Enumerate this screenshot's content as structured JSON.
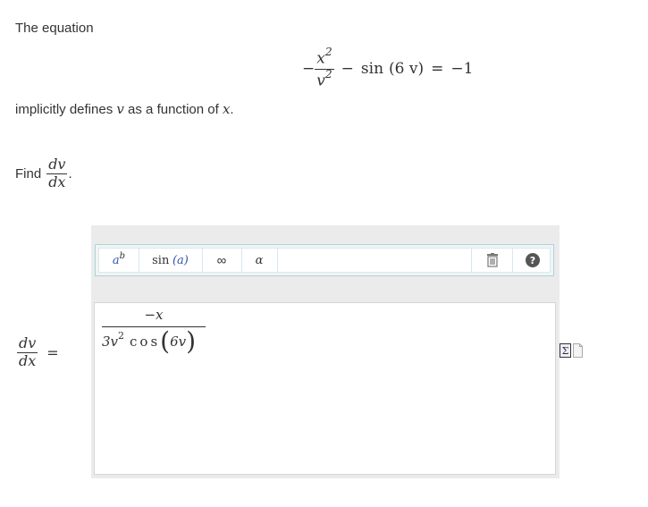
{
  "prompt": {
    "intro": "The equation",
    "implicit_prefix": "implicitly defines",
    "implicit_var_v": "v",
    "implicit_mid": "as a function of",
    "implicit_var_x": "x",
    "implicit_end": ".",
    "find_label": "Find",
    "find_end": "."
  },
  "equation": {
    "neg": "−",
    "num": "x",
    "num_exp": "2",
    "den": "v",
    "den_exp": "2",
    "minus": "−",
    "sin": "sin",
    "arg": "(6 v)",
    "equals": "=",
    "rhs": "−1"
  },
  "derivative": {
    "num": "dv",
    "den": "dx"
  },
  "toolbar": {
    "power_base": "a",
    "power_exp": "b",
    "sin_label": "sin",
    "sin_arg": "(a)",
    "infinity": "∞",
    "alpha": "α",
    "trash_icon": "trash-icon",
    "help_icon": "help-icon"
  },
  "answer": {
    "label_equals": "=",
    "num": "−x",
    "den_coef": "3v",
    "den_exp": "2",
    "den_func": "cos",
    "den_arg": "6v"
  },
  "colors": {
    "accent": "#a9d5e0",
    "panel": "#ebebeb",
    "text": "#333333"
  }
}
